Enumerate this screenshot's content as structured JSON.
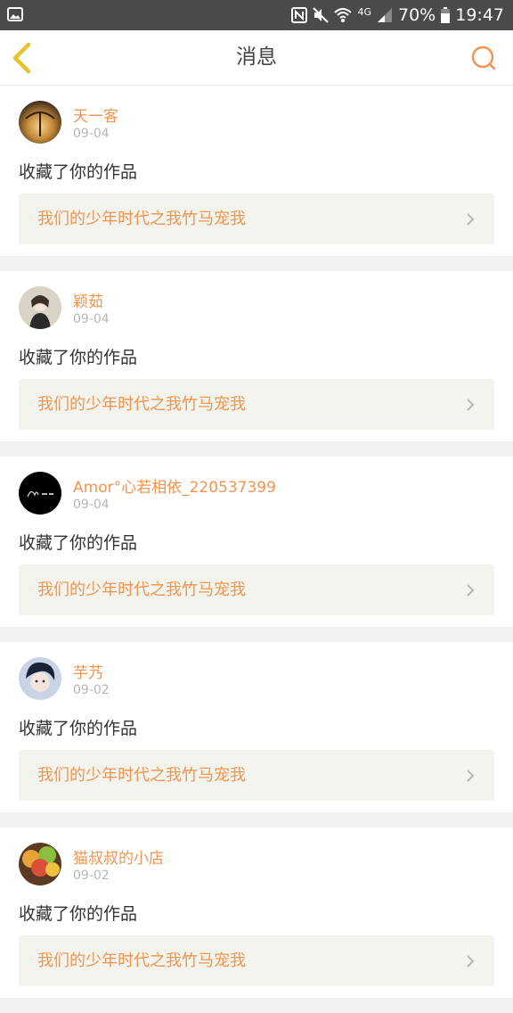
{
  "status_bar": {
    "battery_percent": "70%",
    "time": "19:47",
    "network": "4G",
    "icons": [
      "gallery-icon",
      "nfc-icon",
      "mute-icon",
      "wifi-icon",
      "signal-icon",
      "battery-icon"
    ]
  },
  "header": {
    "title": "消息",
    "back_icon": "chevron-left-icon",
    "search_icon": "search-icon"
  },
  "colors": {
    "accent": "#f0944f",
    "back_arrow": "#e8c22a",
    "work_bg": "#f4f4ee",
    "status_bar_bg": "#4a4a4a"
  },
  "messages": [
    {
      "username": "天一客",
      "date": "09-04",
      "action": "收藏了你的作品",
      "work_title": "我们的少年时代之我竹马宠我"
    },
    {
      "username": "颖茹",
      "date": "09-04",
      "action": "收藏了你的作品",
      "work_title": "我们的少年时代之我竹马宠我"
    },
    {
      "username": "Amor°心若相依_220537399",
      "date": "09-04",
      "action": "收藏了你的作品",
      "work_title": "我们的少年时代之我竹马宠我"
    },
    {
      "username": "芋艿",
      "date": "09-02",
      "action": "收藏了你的作品",
      "work_title": "我们的少年时代之我竹马宠我"
    },
    {
      "username": "猫叔叔的小店",
      "date": "09-02",
      "action": "收藏了你的作品",
      "work_title": "我们的少年时代之我竹马宠我"
    }
  ]
}
